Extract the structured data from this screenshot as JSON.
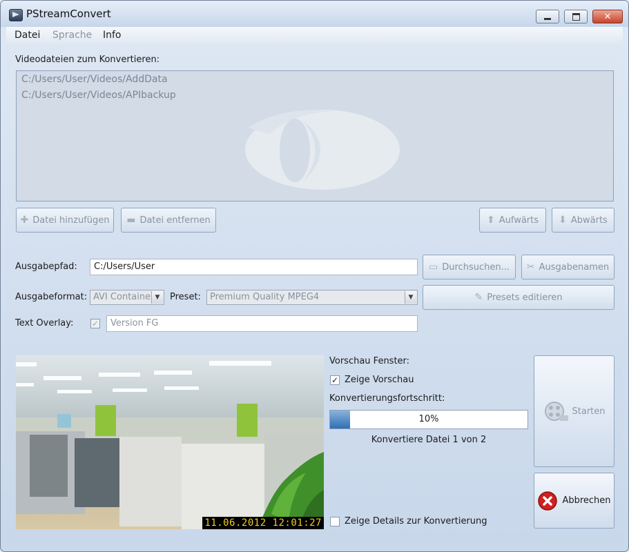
{
  "window": {
    "title": "PStreamConvert",
    "minimize_icon": "minimize-icon",
    "maximize_icon": "maximize-icon",
    "close_icon": "close-icon"
  },
  "menu": {
    "items": [
      {
        "label": "Datei",
        "enabled": true
      },
      {
        "label": "Sprache",
        "enabled": false
      },
      {
        "label": "Info",
        "enabled": true
      }
    ]
  },
  "files": {
    "label": "Videodateien zum Konvertieren:",
    "entries": [
      "C:/Users/User/Videos/AddData",
      "C:/Users/User/Videos/APIbackup"
    ]
  },
  "file_buttons": {
    "add": "Datei hinzufügen",
    "remove": "Datei entfernen",
    "up": "Aufwärts",
    "down": "Abwärts"
  },
  "output": {
    "path_label": "Ausgabepfad:",
    "path_value": "C:/Users/User",
    "browse": "Durchsuchen...",
    "names": "Ausgabenamen",
    "format_label": "Ausgabeformat:",
    "format_value": "AVI Containe",
    "preset_label": "Preset:",
    "preset_value": "Premium Quality MPEG4",
    "edit_presets": "Presets editieren",
    "overlay_label": "Text Overlay:",
    "overlay_checked": true,
    "overlay_value": "Version FG"
  },
  "preview": {
    "timestamp": "11.06.2012  12:01:27",
    "window_label": "Vorschau Fenster:",
    "show_label": "Zeige Vorschau",
    "show_checked": true
  },
  "progress": {
    "label": "Konvertierungsfortschritt:",
    "percent": 10,
    "text": "10%",
    "status": "Konvertiere Datei 1 von 2"
  },
  "details": {
    "label": "Zeige Details zur Konvertierung",
    "checked": false
  },
  "actions": {
    "start": "Starten",
    "abort": "Abbrechen"
  },
  "colors": {
    "progress_fill": "#2e6fb4",
    "abort_icon": "#d21f1f",
    "timestamp_text": "#f2cc22"
  }
}
